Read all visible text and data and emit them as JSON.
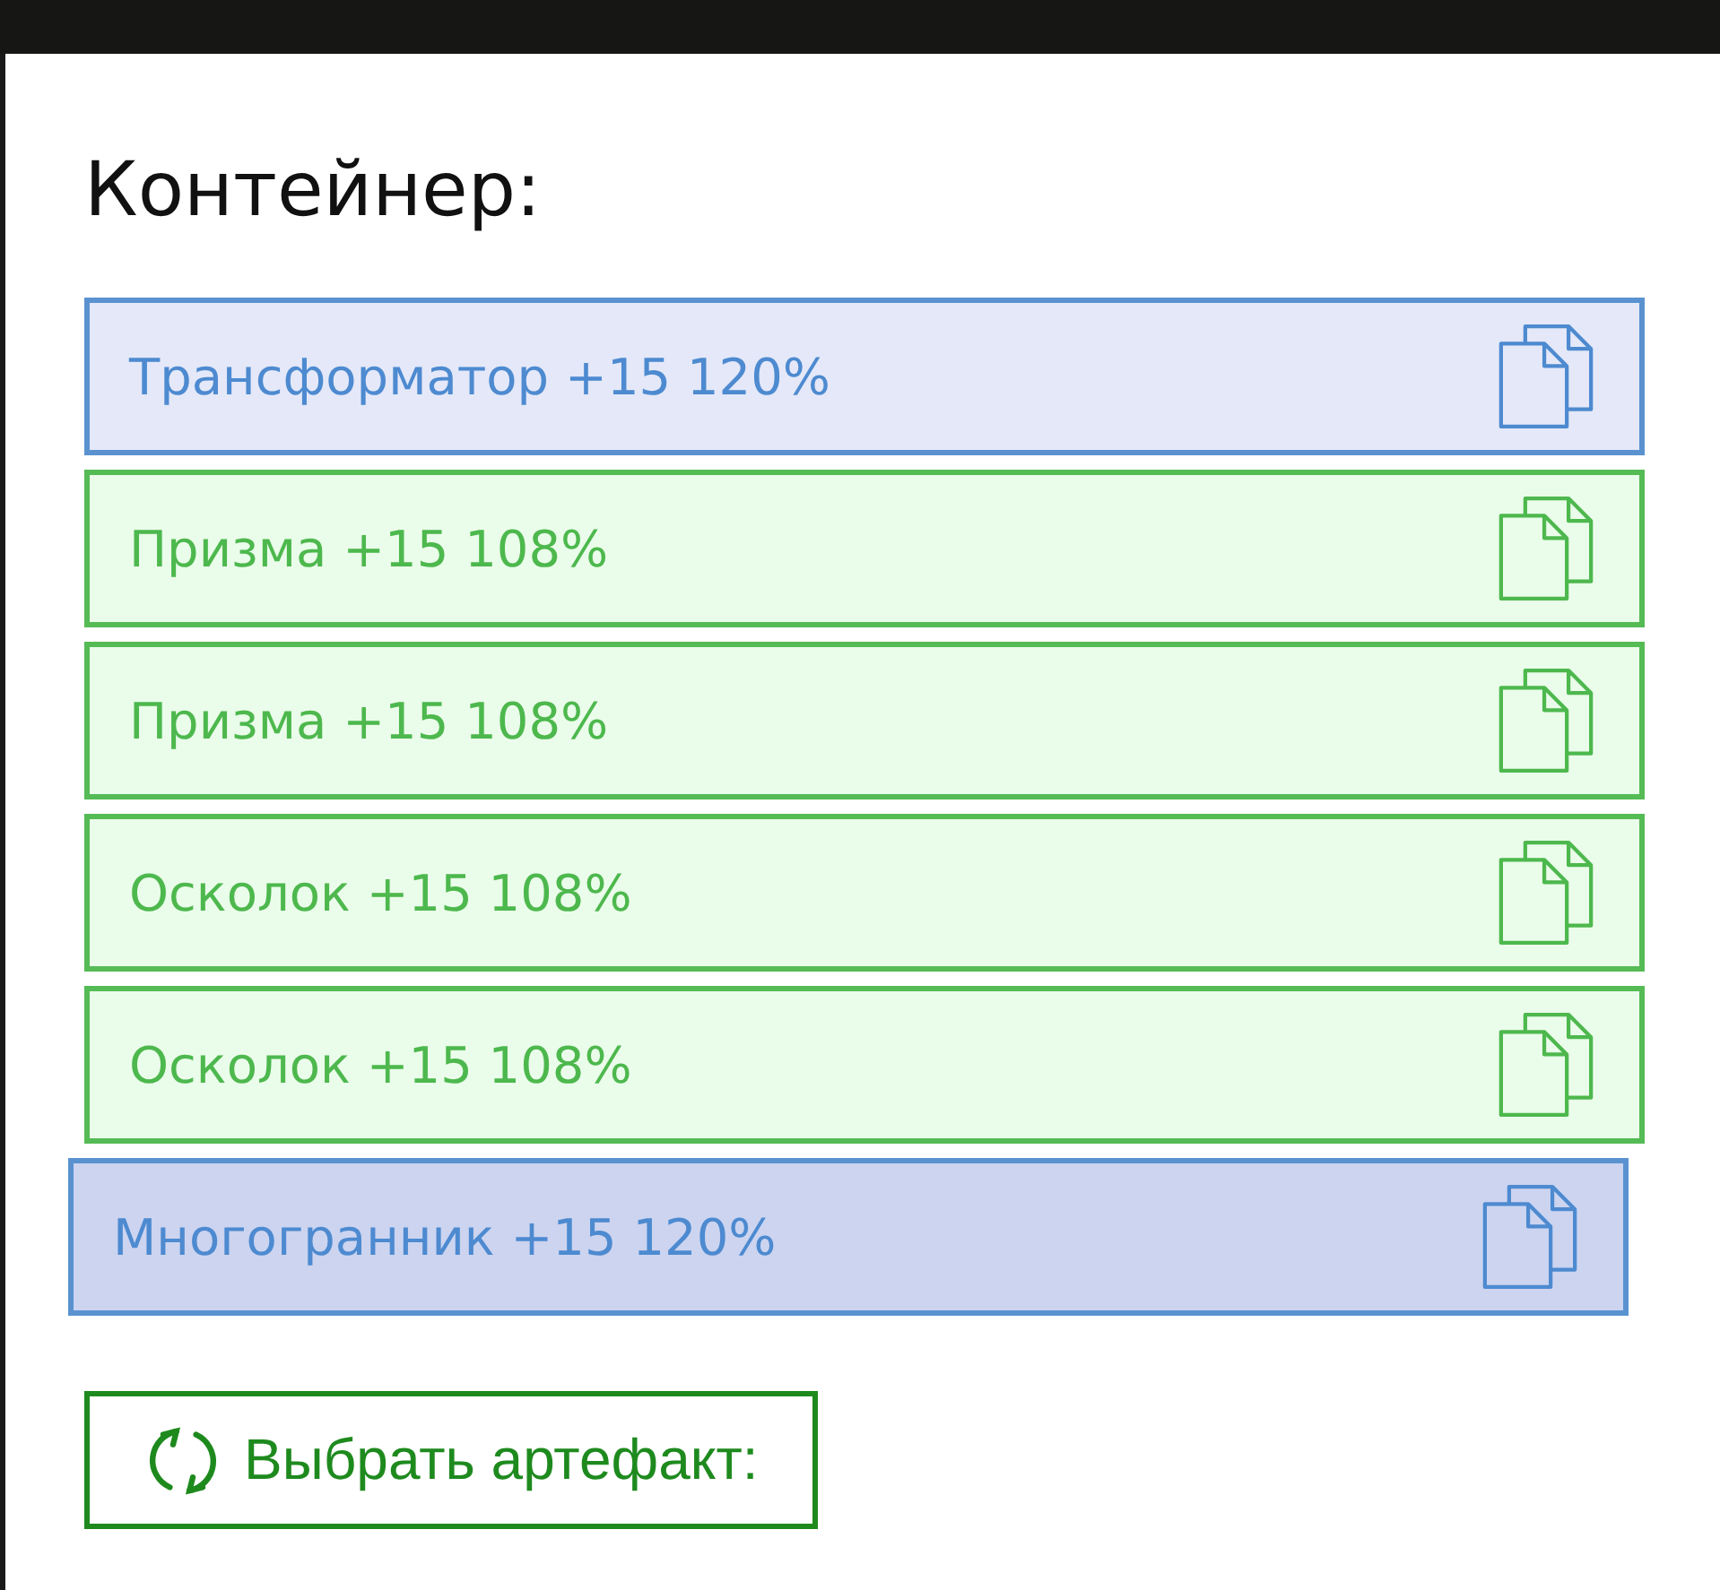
{
  "title": "Контейнер:",
  "items": [
    {
      "label": "Трансформатор +15 120%",
      "kind": "blue",
      "selected": false
    },
    {
      "label": "Призма +15 108%",
      "kind": "green",
      "selected": false
    },
    {
      "label": "Призма +15 108%",
      "kind": "green",
      "selected": false
    },
    {
      "label": "Осколок +15 108%",
      "kind": "green",
      "selected": false
    },
    {
      "label": "Осколок +15 108%",
      "kind": "green",
      "selected": false
    },
    {
      "label": "Многогранник +15 120%",
      "kind": "blue",
      "selected": true
    }
  ],
  "button": {
    "label": "Выбрать артефакт:"
  }
}
